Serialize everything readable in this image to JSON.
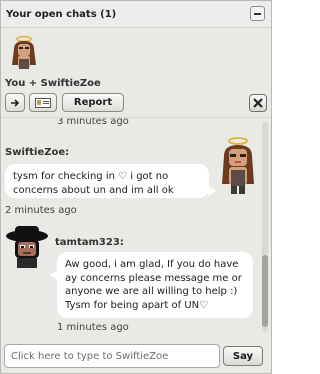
{
  "header": {
    "title": "Your open chats (1)"
  },
  "participants_label": "You + SwiftieZoe",
  "toolbar": {
    "report_label": "Report"
  },
  "messages": [
    {
      "timestamp": "3 minutes ago"
    },
    {
      "sender": "SwiftieZoe:",
      "text": "tysm for checking in ♡ i got no concerns about un and im all ok",
      "timestamp": "2 minutes ago"
    },
    {
      "sender": "tamtam323:",
      "text": "Aw good, i am glad, If you do have ay concerns please message me or anyone we are all willing to help :) Tysm for being apart of UN♡",
      "timestamp": "1 minutes ago"
    }
  ],
  "input": {
    "placeholder": "Click here to type to SwiftieZoe",
    "value": ""
  },
  "say_label": "Say",
  "icons": {
    "collapse": "minus-icon",
    "arrow": "right-arrow-icon",
    "card": "id-card-icon",
    "close": "close-icon"
  }
}
